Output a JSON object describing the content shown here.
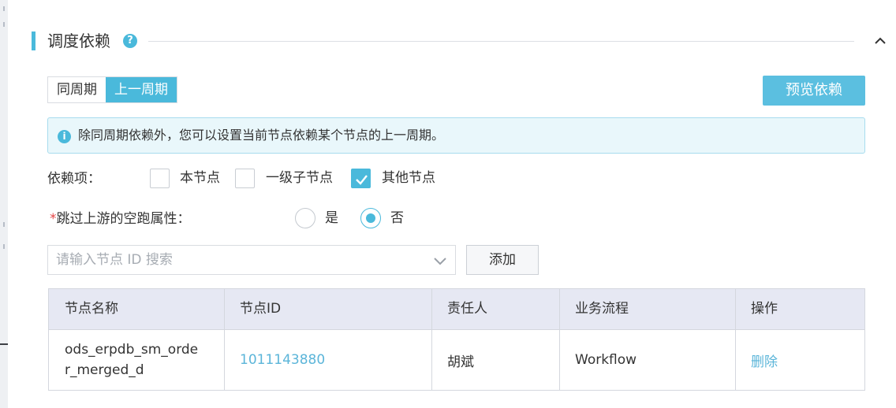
{
  "section": {
    "title": "调度依赖",
    "help_icon": "?"
  },
  "tabs": [
    {
      "label": "同周期",
      "active": false
    },
    {
      "label": "上一周期",
      "active": true
    }
  ],
  "preview_button": "预览依赖",
  "info": {
    "icon": "i",
    "text": "除同周期依赖外，您可以设置当前节点依赖某个节点的上一周期。"
  },
  "dependency": {
    "label": "依赖项：",
    "options": [
      {
        "label": "本节点",
        "checked": false
      },
      {
        "label": "一级子节点",
        "checked": false
      },
      {
        "label": "其他节点",
        "checked": true
      }
    ]
  },
  "skip_upstream": {
    "required_mark": "*",
    "label": "跳过上游的空跑属性：",
    "options": [
      {
        "label": "是",
        "selected": false
      },
      {
        "label": "否",
        "selected": true
      }
    ]
  },
  "search": {
    "placeholder": "请输入节点 ID 搜索"
  },
  "add_button": "添加",
  "table": {
    "columns": [
      "节点名称",
      "节点ID",
      "责任人",
      "业务流程",
      "操作"
    ],
    "rows": [
      {
        "name": "ods_erpdb_sm_order_merged_d",
        "id": "1011143880",
        "owner": "胡斌",
        "workflow": "Workflow",
        "action": "删除"
      }
    ]
  },
  "colors": {
    "accent": "#4ab9db",
    "info_bg": "#e9f7fb",
    "link": "#5bb5d9",
    "required": "#e54545"
  }
}
